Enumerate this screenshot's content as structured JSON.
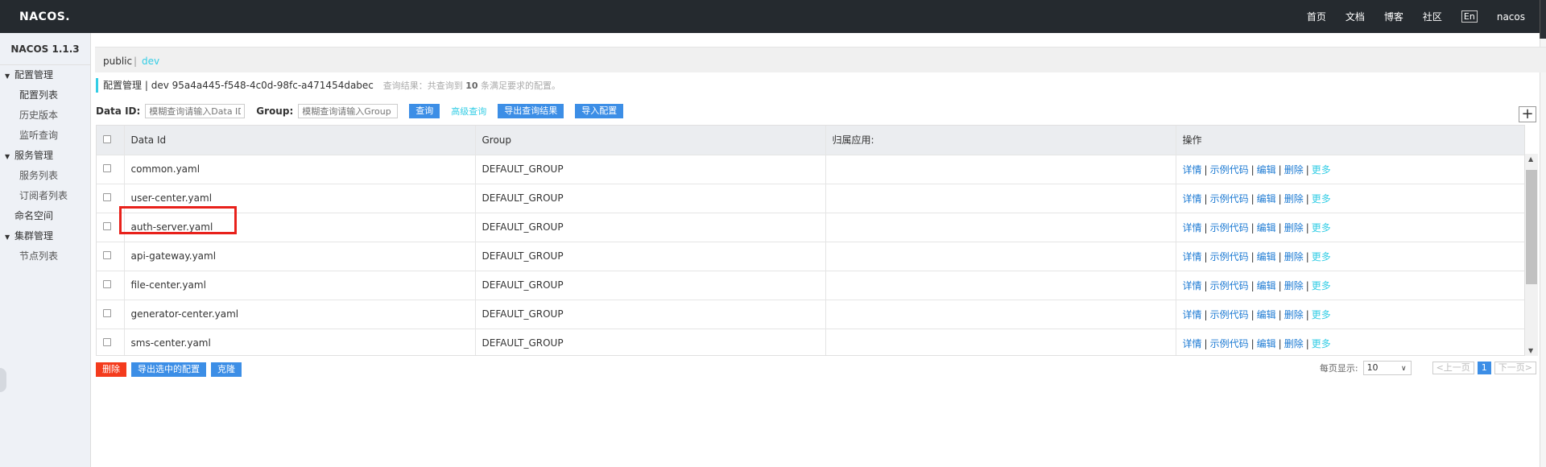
{
  "header": {
    "logo": "NACOS.",
    "nav": [
      "首页",
      "文档",
      "博客",
      "社区"
    ],
    "lang": "En",
    "user": "nacos"
  },
  "sidebar": {
    "version": "NACOS 1.1.3",
    "groups": [
      {
        "label": "配置管理",
        "items": [
          "配置列表",
          "历史版本",
          "监听查询"
        ]
      },
      {
        "label": "服务管理",
        "items": [
          "服务列表",
          "订阅者列表"
        ]
      }
    ],
    "namespace": "命名空间",
    "cluster": {
      "label": "集群管理",
      "items": [
        "节点列表"
      ]
    }
  },
  "namespaces": {
    "public": "public",
    "separator": "|",
    "dev": "dev"
  },
  "heading": {
    "title": "配置管理",
    "sep": "|",
    "namespace_id": "dev  95a4a445-f548-4c0d-98fc-a471454dabec",
    "result_prefix": "查询结果：共查询到",
    "result_count": "10",
    "result_suffix": "条满足要求的配置。"
  },
  "search": {
    "dataid_label": "Data ID:",
    "dataid_placeholder": "模糊查询请输入Data ID",
    "group_label": "Group:",
    "group_placeholder": "模糊查询请输入Group",
    "query_btn": "查询",
    "advanced_link": "高级查询",
    "export_result_btn": "导出查询结果",
    "import_btn": "导入配置",
    "add_btn": "+"
  },
  "table": {
    "columns": [
      "Data Id",
      "Group",
      "归属应用:",
      "操作"
    ],
    "rows": [
      {
        "data_id": "common.yaml",
        "group": "DEFAULT_GROUP",
        "app": ""
      },
      {
        "data_id": "user-center.yaml",
        "group": "DEFAULT_GROUP",
        "app": ""
      },
      {
        "data_id": "auth-server.yaml",
        "group": "DEFAULT_GROUP",
        "app": ""
      },
      {
        "data_id": "api-gateway.yaml",
        "group": "DEFAULT_GROUP",
        "app": ""
      },
      {
        "data_id": "file-center.yaml",
        "group": "DEFAULT_GROUP",
        "app": ""
      },
      {
        "data_id": "generator-center.yaml",
        "group": "DEFAULT_GROUP",
        "app": ""
      },
      {
        "data_id": "sms-center.yaml",
        "group": "DEFAULT_GROUP",
        "app": ""
      }
    ],
    "ops": {
      "detail": "详情",
      "sample": "示例代码",
      "edit": "编辑",
      "delete": "删除",
      "more": "更多"
    }
  },
  "bottom": {
    "delete_btn": "删除",
    "export_selected_btn": "导出选中的配置",
    "clone_btn": "克隆"
  },
  "pager": {
    "per_page_label": "每页显示:",
    "per_page_value": "10",
    "prev": "<上一页",
    "current": "1",
    "next": "下一页>"
  }
}
